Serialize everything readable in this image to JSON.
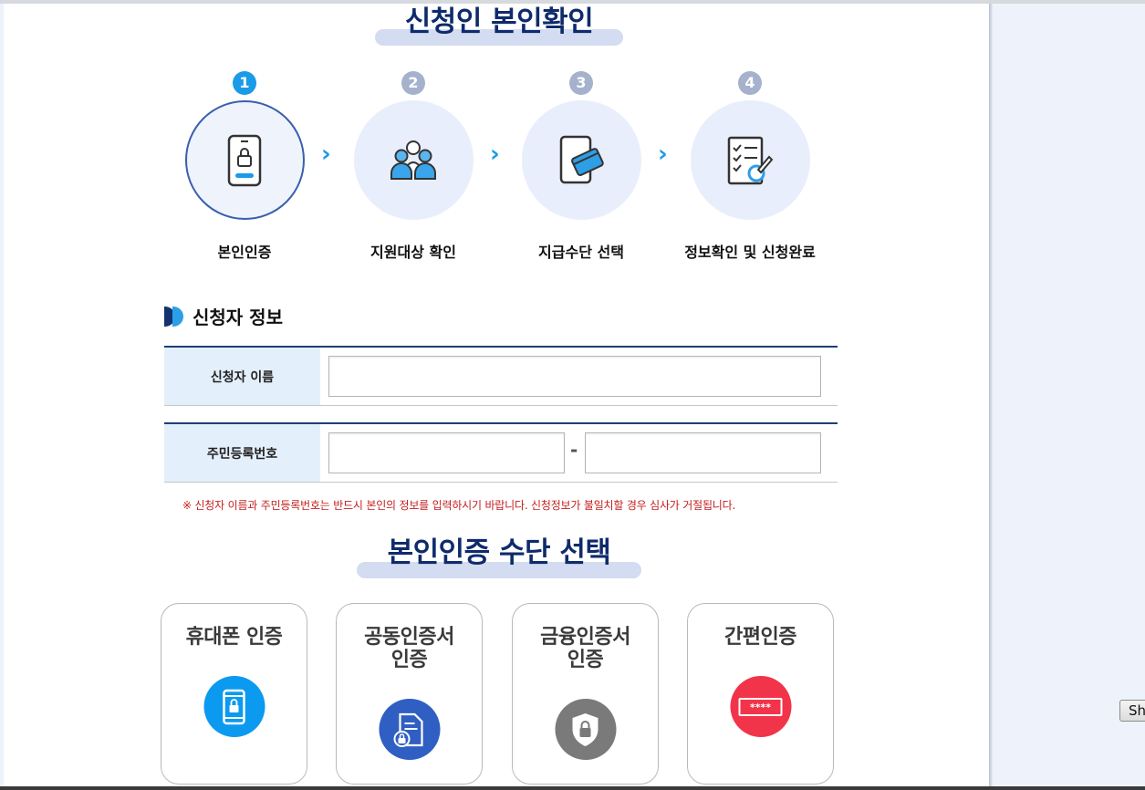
{
  "titles": {
    "identity_check": "신청인 본인확인",
    "auth_method": "본인인증 수단 선택"
  },
  "steps": [
    {
      "number": "1",
      "label": "본인인증",
      "icon": "phone-lock-icon",
      "active": true
    },
    {
      "number": "2",
      "label": "지원대상 확인",
      "icon": "people-group-icon",
      "active": false
    },
    {
      "number": "3",
      "label": "지급수단 선택",
      "icon": "card-payment-icon",
      "active": false
    },
    {
      "number": "4",
      "label": "정보확인 및 신청완료",
      "icon": "checklist-icon",
      "active": false
    }
  ],
  "applicant": {
    "heading": "신청자 정보",
    "name_label": "신청자 이름",
    "name_value": "",
    "rrn_label": "주민등록번호",
    "rrn_front_value": "",
    "rrn_back_value": "",
    "rrn_separator": "-",
    "notice": "※ 신청자 이름과 주민등록번호는 반드시 본인의 정보를 입력하시기 바랍니다. 신청정보가 불일치할 경우 심사가 거절됩니다."
  },
  "auth_methods": [
    {
      "label": "휴대폰 인증",
      "icon": "mobile-phone-icon",
      "color": "#0b9af0"
    },
    {
      "label": "공동인증서 인증",
      "icon": "certificate-document-icon",
      "color": "#2f5fc2"
    },
    {
      "label": "금융인증서 인증",
      "icon": "shield-lock-icon",
      "color": "#7a7a7a"
    },
    {
      "label": "간편인증",
      "icon": "password-asterisk-icon",
      "color": "#f2344a"
    }
  ],
  "side_button_label": "Sh",
  "colors": {
    "accent": "#1a9be8",
    "title": "#0f2b6c",
    "notice": "#c41e1e"
  }
}
